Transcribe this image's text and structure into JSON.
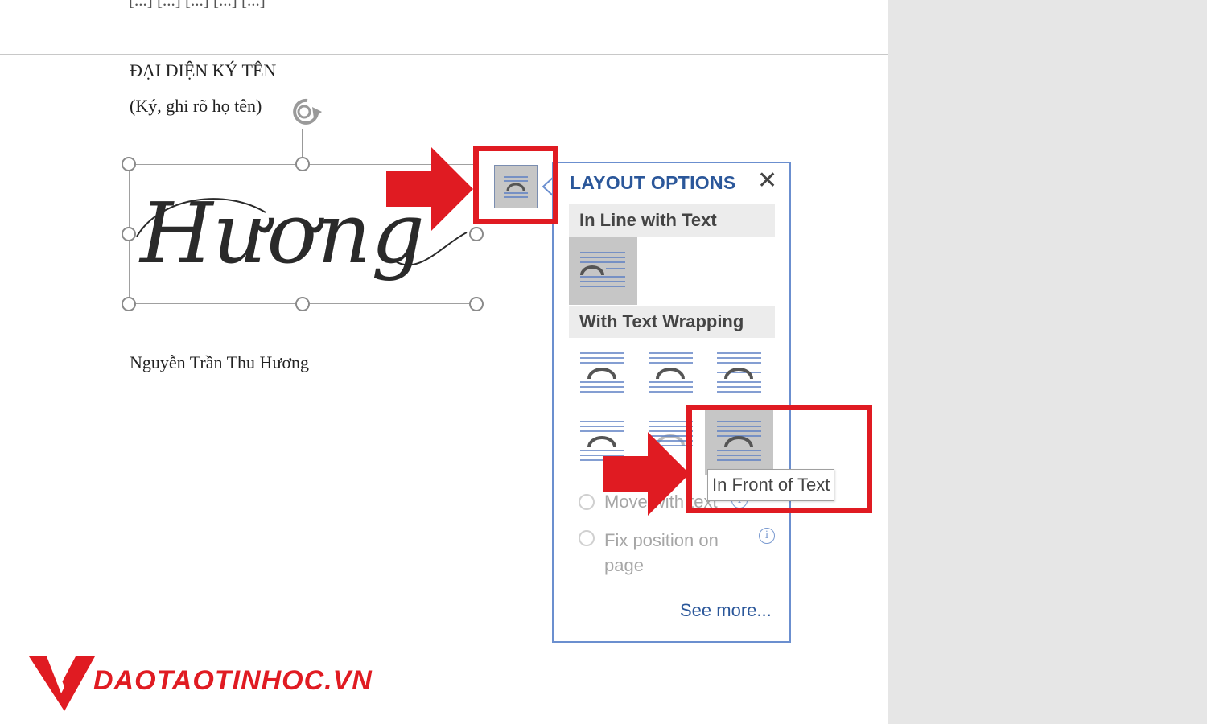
{
  "document": {
    "top_text": "[...] [...] [...] [...] [...]",
    "signature_heading": "ĐẠI DIỆN KÝ TÊN",
    "signature_subtitle": "(Ký, ghi rõ họ tên)",
    "signature_script": "Hương",
    "signer_name": "Nguyễn Trần Thu Hương"
  },
  "layout_options": {
    "title": "LAYOUT OPTIONS",
    "close_glyph": "✕",
    "section_inline": "In Line with Text",
    "section_wrapping": "With Text Wrapping",
    "selected_option": "In Front of Text",
    "radio_move": "Move with text",
    "radio_fix": "Fix position on page",
    "info_glyph": "i",
    "see_more": "See more...",
    "tooltip": "In Front of Text"
  },
  "annotations": {
    "highlight_color": "#e01b22"
  },
  "logo": {
    "text": "DAOTAOTINHOC.VN",
    "color": "#e01b22"
  },
  "colors": {
    "accent_blue": "#2b579a",
    "panel_border": "#6b8fcf",
    "selected_bg": "#c6c6c6"
  }
}
